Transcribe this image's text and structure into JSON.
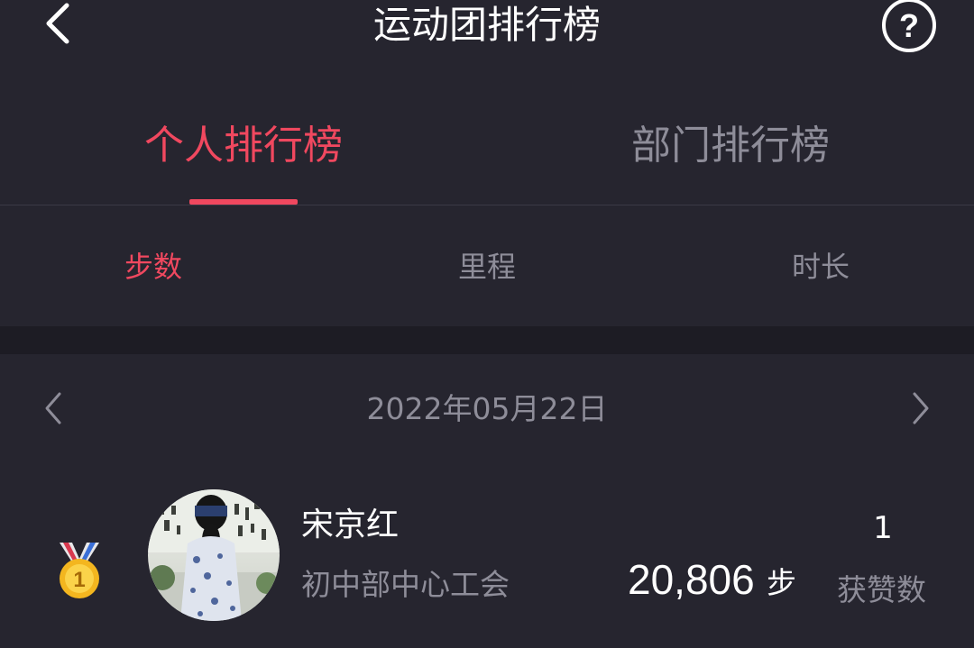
{
  "header": {
    "title": "运动团排行榜",
    "back_icon": "chevron-left-icon",
    "help_icon": "question-circle-icon"
  },
  "colors": {
    "background": "#26252f",
    "accent": "#f0485f",
    "muted": "#8e8d99",
    "separator_band": "#1d1c24"
  },
  "main_tabs": [
    {
      "label": "个人排行榜",
      "active": true
    },
    {
      "label": "部门排行榜",
      "active": false
    }
  ],
  "sub_tabs": [
    {
      "label": "步数",
      "active": true
    },
    {
      "label": "里程",
      "active": false
    },
    {
      "label": "时长",
      "active": false
    }
  ],
  "date_nav": {
    "date": "2022年05月22日",
    "prev_icon": "chevron-left-icon",
    "next_icon": "chevron-right-icon"
  },
  "ranking": [
    {
      "rank": 1,
      "rank_icon": "gold-medal-icon",
      "name": "宋京红",
      "department": "初中部中心工会",
      "steps": "20,806",
      "step_unit": "步",
      "likes": "1",
      "likes_label": "获赞数"
    }
  ]
}
